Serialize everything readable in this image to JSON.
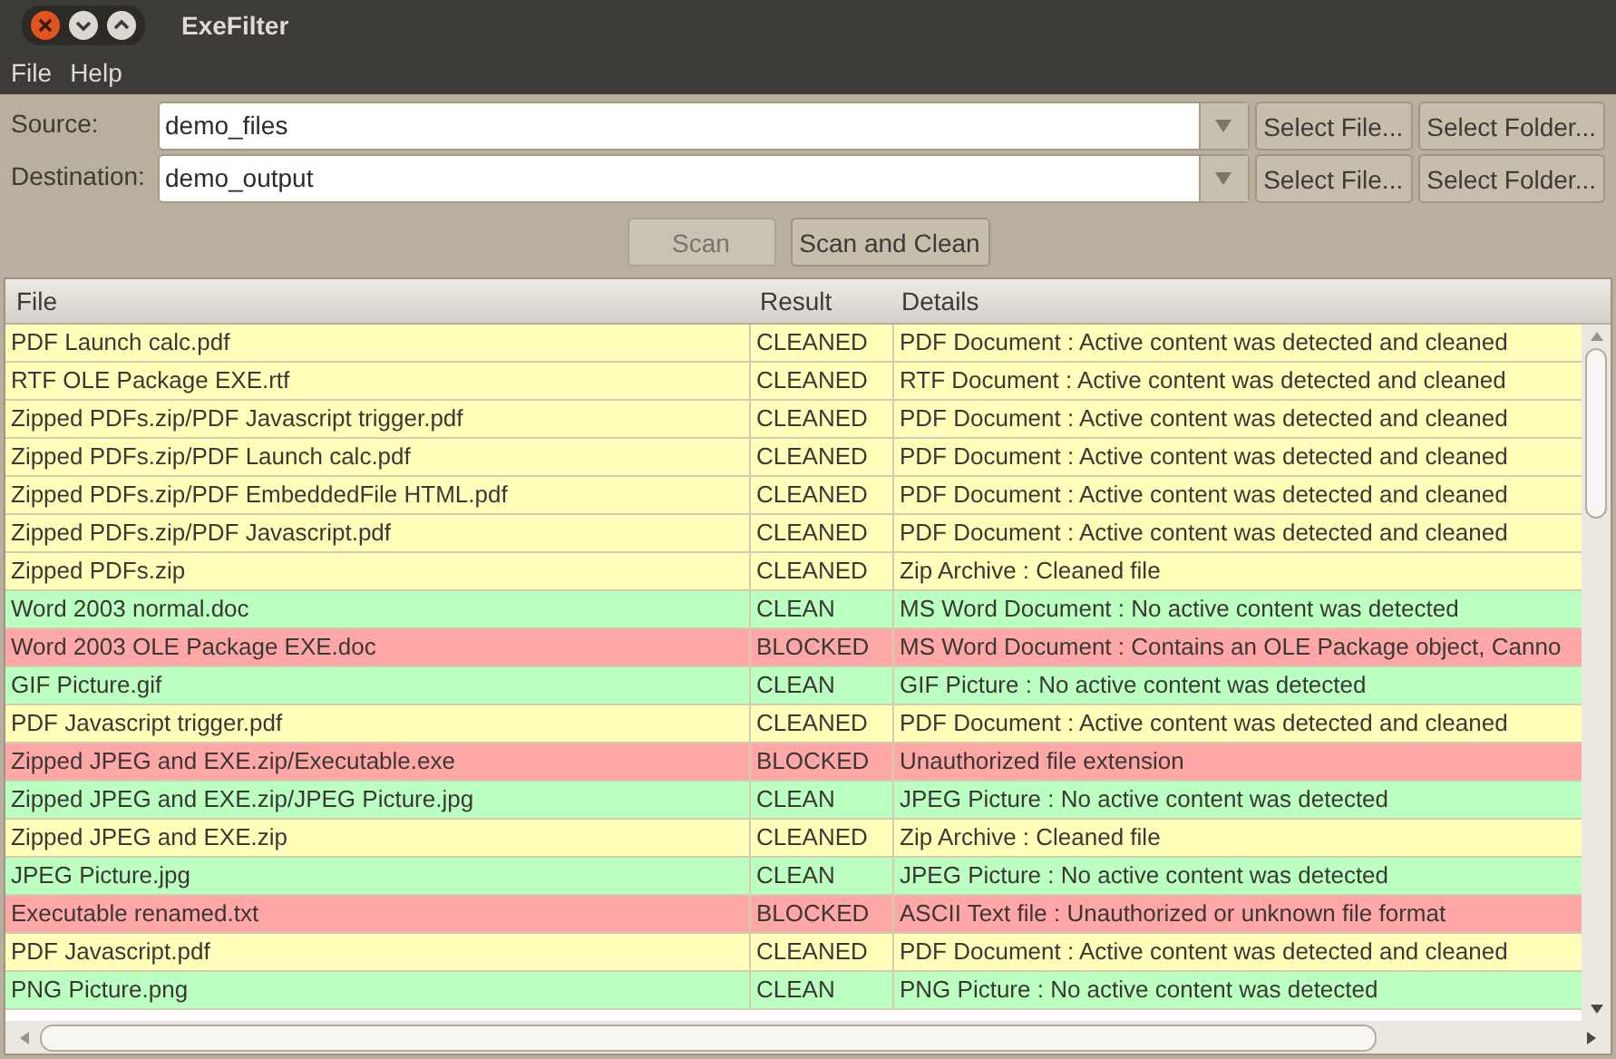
{
  "window": {
    "title": "ExeFilter"
  },
  "menu": [
    "File",
    "Help"
  ],
  "source": {
    "label": "Source:",
    "value": "demo_files",
    "buttons": [
      "Select File...",
      "Select Folder..."
    ]
  },
  "destination": {
    "label": "Destination:",
    "value": "demo_output",
    "buttons": [
      "Select File...",
      "Select Folder..."
    ]
  },
  "actions": [
    {
      "label": "Scan",
      "disabled": true
    },
    {
      "label": "Scan and Clean",
      "disabled": false
    }
  ],
  "table": {
    "columns": [
      "File",
      "Result",
      "Details"
    ],
    "rows": [
      {
        "file": "PDF Launch calc.pdf",
        "result": "CLEANED",
        "details": "PDF Document : Active content was detected and cleaned",
        "color": "#ffffb9"
      },
      {
        "file": "RTF OLE Package EXE.rtf",
        "result": "CLEANED",
        "details": "RTF Document : Active content was detected and cleaned",
        "color": "#ffffb9"
      },
      {
        "file": "Zipped PDFs.zip/PDF Javascript trigger.pdf",
        "result": "CLEANED",
        "details": "PDF Document : Active content was detected and cleaned",
        "color": "#ffffb9"
      },
      {
        "file": "Zipped PDFs.zip/PDF Launch calc.pdf",
        "result": "CLEANED",
        "details": "PDF Document : Active content was detected and cleaned",
        "color": "#ffffb9"
      },
      {
        "file": "Zipped PDFs.zip/PDF EmbeddedFile HTML.pdf",
        "result": "CLEANED",
        "details": "PDF Document : Active content was detected and cleaned",
        "color": "#ffffb9"
      },
      {
        "file": "Zipped PDFs.zip/PDF Javascript.pdf",
        "result": "CLEANED",
        "details": "PDF Document : Active content was detected and cleaned",
        "color": "#ffffb9"
      },
      {
        "file": "Zipped PDFs.zip",
        "result": "CLEANED",
        "details": "Zip Archive : Cleaned file",
        "color": "#ffffb9"
      },
      {
        "file": "Word 2003 normal.doc",
        "result": "CLEAN",
        "details": "MS Word Document : No active content was detected",
        "color": "#bbffc1"
      },
      {
        "file": "Word 2003 OLE Package EXE.doc",
        "result": "BLOCKED",
        "details": "MS Word Document : Contains an OLE Package object, Canno",
        "color": "#ffa6a6"
      },
      {
        "file": "GIF Picture.gif",
        "result": "CLEAN",
        "details": "GIF Picture : No active content was detected",
        "color": "#bbffc1"
      },
      {
        "file": "PDF Javascript trigger.pdf",
        "result": "CLEANED",
        "details": "PDF Document : Active content was detected and cleaned",
        "color": "#ffffb9"
      },
      {
        "file": "Zipped JPEG and EXE.zip/Executable.exe",
        "result": "BLOCKED",
        "details": "Unauthorized file extension",
        "color": "#ffa6a6"
      },
      {
        "file": "Zipped JPEG and EXE.zip/JPEG Picture.jpg",
        "result": "CLEAN",
        "details": "JPEG Picture : No active content was detected",
        "color": "#bbffc1"
      },
      {
        "file": "Zipped JPEG and EXE.zip",
        "result": "CLEANED",
        "details": "Zip Archive : Cleaned file",
        "color": "#ffffb9"
      },
      {
        "file": "JPEG Picture.jpg",
        "result": "CLEAN",
        "details": "JPEG Picture : No active content was detected",
        "color": "#bbffc1"
      },
      {
        "file": "Executable renamed.txt",
        "result": "BLOCKED",
        "details": "ASCII Text file : Unauthorized or unknown file format",
        "color": "#ffa6a6"
      },
      {
        "file": "PDF Javascript.pdf",
        "result": "CLEANED",
        "details": "PDF Document : Active content was detected and cleaned",
        "color": "#ffffb9"
      },
      {
        "file": "PNG Picture.png",
        "result": "CLEAN",
        "details": "PNG Picture : No active content was detected",
        "color": "#bbffc1"
      }
    ]
  }
}
